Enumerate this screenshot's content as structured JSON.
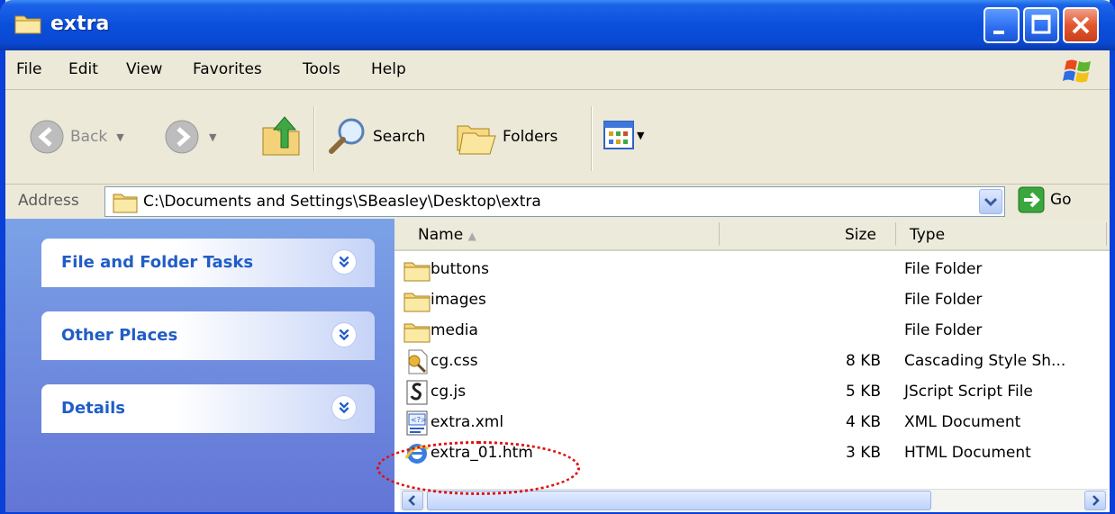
{
  "window": {
    "title": "extra"
  },
  "menu": [
    "File",
    "Edit",
    "View",
    "Favorites",
    "Tools",
    "Help"
  ],
  "toolbar": {
    "back": "Back",
    "search": "Search",
    "folders": "Folders"
  },
  "address": {
    "label": "Address",
    "path": "C:\\Documents and Settings\\SBeasley\\Desktop\\extra",
    "go": "Go"
  },
  "tasks": [
    "File and Folder Tasks",
    "Other Places",
    "Details"
  ],
  "columns": {
    "name": "Name",
    "size": "Size",
    "type": "Type"
  },
  "files": [
    {
      "name": "buttons",
      "size": "",
      "type": "File Folder",
      "icon": "folder-icon"
    },
    {
      "name": "images",
      "size": "",
      "type": "File Folder",
      "icon": "folder-icon"
    },
    {
      "name": "media",
      "size": "",
      "type": "File Folder",
      "icon": "folder-icon"
    },
    {
      "name": "cg.css",
      "size": "8 KB",
      "type": "Cascading Style Sh...",
      "icon": "css-file-icon"
    },
    {
      "name": "cg.js",
      "size": "5 KB",
      "type": "JScript Script File",
      "icon": "js-file-icon"
    },
    {
      "name": "extra.xml",
      "size": "4 KB",
      "type": "XML Document",
      "icon": "xml-file-icon"
    },
    {
      "name": "extra_01.htm",
      "size": "3 KB",
      "type": "HTML Document",
      "icon": "ie-html-icon"
    }
  ],
  "colors": {
    "titlebar": "#0a4fdb",
    "taskpane": "#6f8fe0",
    "highlight_circle": "#e01010"
  }
}
